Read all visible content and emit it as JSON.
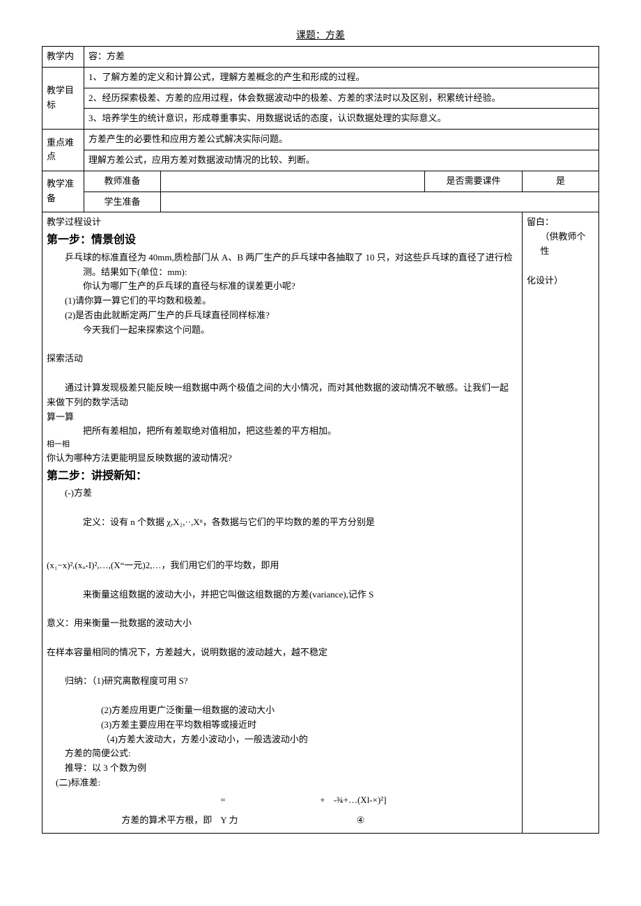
{
  "title": "课题：方差",
  "row_content": {
    "label": "教学内",
    "value": "容：方差"
  },
  "row_goals": {
    "label_top": "教学目",
    "label_bottom": "标",
    "g1": "1、了解方差的定义和计算公式，理解方差概念的产生和形成的过程。",
    "g2": "2、经历探索极差、方差的应用过程，体会数据波动中的极差、方差的求法时以及区别，积累统计经验。",
    "g3": "3、培养学生的统计意识，形成尊重事实、用数据说话的态度，认识数据处理的实际意义。"
  },
  "row_focus": {
    "label_top": "重点难",
    "label_bottom": "点",
    "f1": "方差产生的必要性和应用方差公式解决实际问题。",
    "f2": "理解方差公式，应用方差对数据波动情况的比较、判断。"
  },
  "row_prep": {
    "label_top": "教学准",
    "label_bottom": "备",
    "teacher": "教师准备",
    "student": "学生准备",
    "need_courseware_label": "是否需要课件",
    "need_courseware_value": "是"
  },
  "margin": {
    "l1": "留白：",
    "l2": "（供教师个性",
    "l3": "化设计）"
  },
  "body": {
    "design_label": "教学过程设计",
    "step1_head": "第一步：情景创设",
    "s1_p1": "乒乓球的标准直径为 40mm,质检部门从 A、B 两厂生产的乒乓球中各抽取了 10 只，对这些乒乓球的直径了进行检测。结果如下(单位：mm):",
    "s1_q": "你认为哪厂生产的乒乓球的直径与标准的误差更小呢?",
    "s1_a": "(1)请你算一算它们的平均数和极差。",
    "s1_b": "(2)是否由此就断定两厂生产的乒乓球直径同样标准?",
    "s1_c": "今天我们一起来探索这个问题。",
    "explore_head": "探索活动",
    "explore_p": "通过计算发现极差只能反映一组数据中两个极值之间的大小情况，而对其他数据的波动情况不敏感。让我们一起来做下列的数学活动",
    "calc_head": "算一算",
    "calc_p": "把所有差相加，把所有差取绝对值相加，把这些差的平方相加。",
    "think_head": "相一相",
    "think_q": "你认为哪种方法更能明显反映数据的波动情况?",
    "step2_head": "第二步：讲授新知：",
    "s2_sub1": "(-)方差",
    "s2_def": "定义：设有 n 个数据 χ,X₂,··,Xⁿ，各数据与它们的平均数的差的平方分别是",
    "s2_formula_line": "(x₁−x)²ᵣ(xᵤ-I)²,…,(X“一元)2,…，我们用它们的平均数，即用",
    "s2_measure": "来衡量这组数据的波动大小，并把它叫做这组数据的方差(variance),记作 S",
    "s2_meaning": "意义：用来衡量一批数据的波动大小",
    "s2_sample": "在样本容量相同的情况下，方差越大，说明数据的波动越大，越不稳定",
    "s2_sum_head": "归纳：（1)研究离散程度可用 S?",
    "s2_sum2": "(2)方差应用更广泛衡量一组数据的波动大小",
    "s2_sum3": "(3)方差主要应用在平均数相等或接近时",
    "s2_sum4": "（4)方差大波动大，方差小波动小，一般选波动小的",
    "s2_simple": "方差的简便公式:",
    "s2_derive": "推导：以 3 个数为例",
    "s2_sub2": "(二)标准差:",
    "formula_eq": "=",
    "formula_plus": "+",
    "formula_tail": "-¾+…(Xl-×)²]",
    "formula_desc": "方差的算术平方根，即",
    "formula_yli": "Y 力",
    "formula_circ": "④"
  }
}
